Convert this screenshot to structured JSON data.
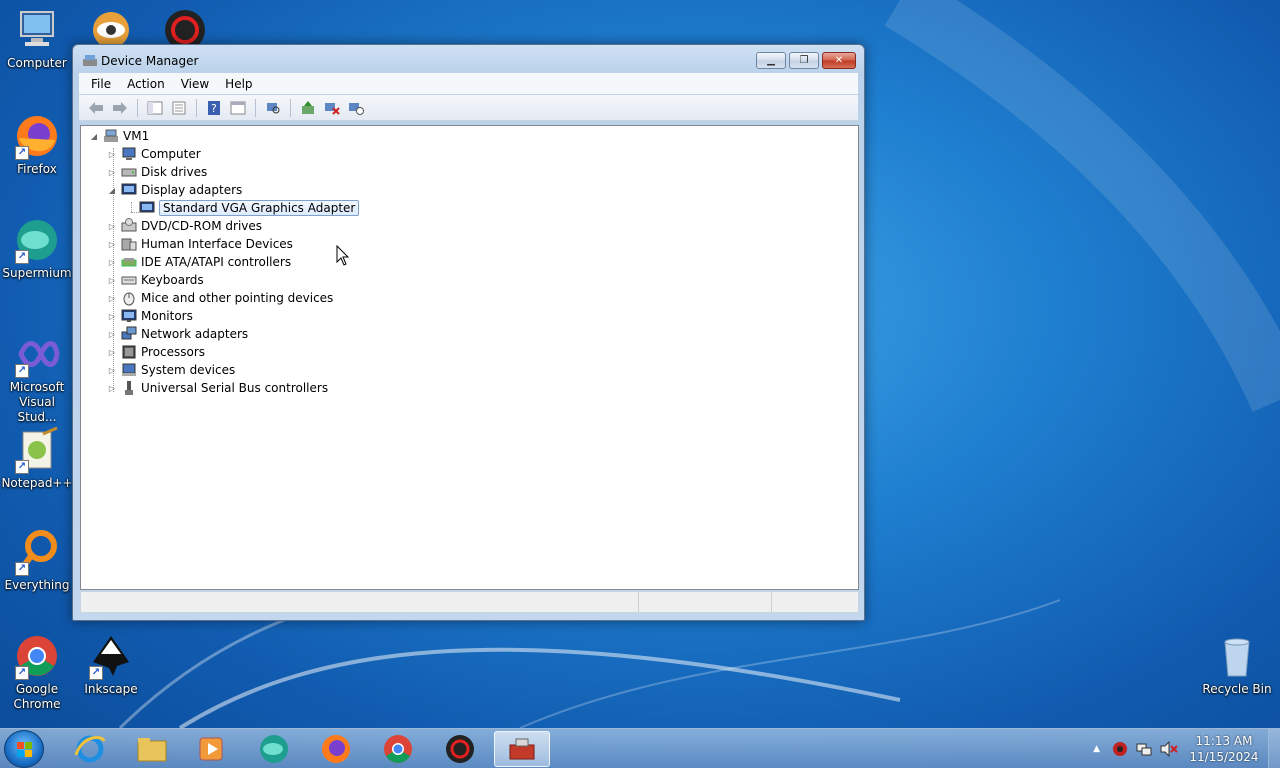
{
  "desktop": {
    "icons": [
      {
        "label": "Computer",
        "icon": "computer-icon"
      },
      {
        "label": "Firefox",
        "icon": "firefox-icon"
      },
      {
        "label": "Supermium",
        "icon": "supermium-icon"
      },
      {
        "label": "Microsoft Visual Stud...",
        "icon": "visual-studio-icon"
      },
      {
        "label": "Notepad++",
        "icon": "notepadpp-icon"
      },
      {
        "label": "Everything",
        "icon": "everything-icon"
      },
      {
        "label": "Google Chrome",
        "icon": "chrome-icon"
      },
      {
        "label": "Inkscape",
        "icon": "inkscape-icon"
      },
      {
        "label": "Recycle Bin",
        "icon": "recycle-bin-icon"
      }
    ]
  },
  "window": {
    "title": "Device Manager",
    "menu": [
      "File",
      "Action",
      "View",
      "Help"
    ],
    "toolbar": [
      "back-icon",
      "forward-icon",
      "show-hide-console-tree-icon",
      "properties-icon",
      "help-icon",
      "action-pane-icon",
      "scan-hardware-icon",
      "update-driver-icon",
      "uninstall-icon",
      "disable-icon"
    ],
    "tree": {
      "root": "VM1",
      "items": [
        {
          "label": "Computer",
          "icon": "computer-device-icon",
          "expanded": false
        },
        {
          "label": "Disk drives",
          "icon": "disk-drive-icon",
          "expanded": false
        },
        {
          "label": "Display adapters",
          "icon": "display-adapter-icon",
          "expanded": true
        },
        {
          "label": "Standard VGA Graphics Adapter",
          "icon": "display-adapter-icon",
          "child": true,
          "selected": true
        },
        {
          "label": "DVD/CD-ROM drives",
          "icon": "dvd-drive-icon",
          "expanded": false
        },
        {
          "label": "Human Interface Devices",
          "icon": "hid-icon",
          "expanded": false
        },
        {
          "label": "IDE ATA/ATAPI controllers",
          "icon": "ide-controller-icon",
          "expanded": false
        },
        {
          "label": "Keyboards",
          "icon": "keyboard-icon",
          "expanded": false
        },
        {
          "label": "Mice and other pointing devices",
          "icon": "mouse-icon",
          "expanded": false
        },
        {
          "label": "Monitors",
          "icon": "monitor-icon",
          "expanded": false
        },
        {
          "label": "Network adapters",
          "icon": "network-adapter-icon",
          "expanded": false
        },
        {
          "label": "Processors",
          "icon": "processor-icon",
          "expanded": false
        },
        {
          "label": "System devices",
          "icon": "system-device-icon",
          "expanded": false
        },
        {
          "label": "Universal Serial Bus controllers",
          "icon": "usb-controller-icon",
          "expanded": false
        }
      ]
    }
  },
  "taskbar": {
    "pinned": [
      "internet-explorer-icon",
      "file-explorer-icon",
      "media-player-icon",
      "supermium-icon",
      "firefox-icon",
      "chrome-icon",
      "app-red-icon",
      "device-manager-icon"
    ],
    "clock_time": "11:13 AM",
    "clock_date": "11/15/2024"
  },
  "colors": {
    "desktop": "#1a72c9",
    "selection": "#dcebfc",
    "close": "#c03a24"
  }
}
